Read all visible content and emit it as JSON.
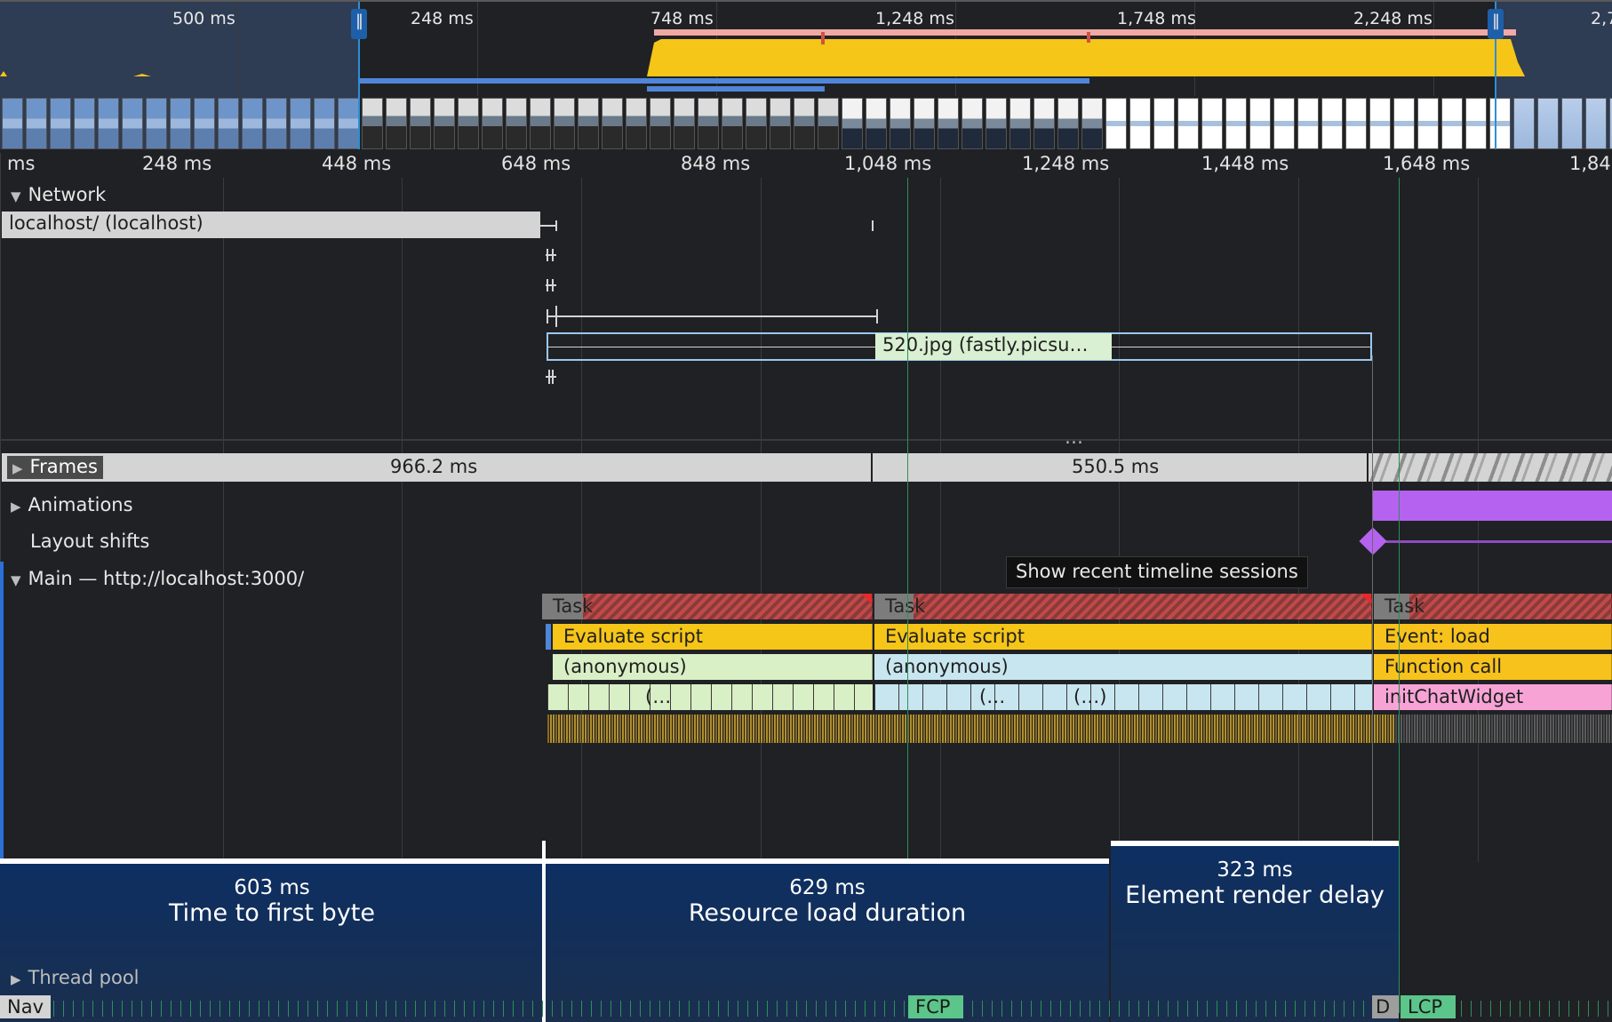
{
  "overview": {
    "ticks": [
      "500 ms",
      "248 ms",
      "748 ms",
      "1,248 ms",
      "1,748 ms",
      "2,248 ms",
      "2,7"
    ]
  },
  "ruler": {
    "ticks": [
      "ms",
      "248 ms",
      "448 ms",
      "648 ms",
      "848 ms",
      "1,048 ms",
      "1,248 ms",
      "1,448 ms",
      "1,648 ms",
      "1,84"
    ]
  },
  "network": {
    "title": "Network",
    "requests": [
      {
        "label": "localhost/ (localhost)"
      },
      {
        "label": "520.jpg (fastly.picsu…"
      }
    ],
    "more": "…"
  },
  "frames": {
    "title": "Frames",
    "durations": [
      "966.2 ms",
      "550.5 ms"
    ]
  },
  "animations": {
    "title": "Animations"
  },
  "layout_shifts": {
    "title": "Layout shifts"
  },
  "tooltip": {
    "text": "Show recent timeline sessions"
  },
  "main": {
    "title": "Main — http://localhost:3000/",
    "tasks": [
      "Task",
      "Task",
      "Task"
    ],
    "level1": [
      "Evaluate script",
      "Evaluate script",
      "Event: load"
    ],
    "level2": [
      "(anonymous)",
      "(anonymous)",
      "Function call"
    ],
    "level3": [
      "(…",
      "(…",
      "(…)",
      "initChatWidget"
    ]
  },
  "lcp_breakdown": [
    {
      "value": "603 ms",
      "label": "Time to first byte"
    },
    {
      "value": "629 ms",
      "label": "Resource load duration"
    },
    {
      "value": "323 ms",
      "label": "Element render delay"
    }
  ],
  "thread_pool": {
    "title": "Thread pool"
  },
  "markers": {
    "nav": "Nav",
    "fcp": "FCP",
    "dcl": "D",
    "lcp": "LCP"
  },
  "colors": {
    "task_red": "#d0504a",
    "evaluate_yellow": "#f5c518",
    "anonymous_green": "#d9efc5",
    "anonymous_blue": "#c8e6ef",
    "function_call": "#f7c21c",
    "init_pink": "#f7a3d6",
    "breakdown_navy": "#0d2f62",
    "animation_purple": "#b562f0",
    "marker_green": "#5bc58a"
  }
}
